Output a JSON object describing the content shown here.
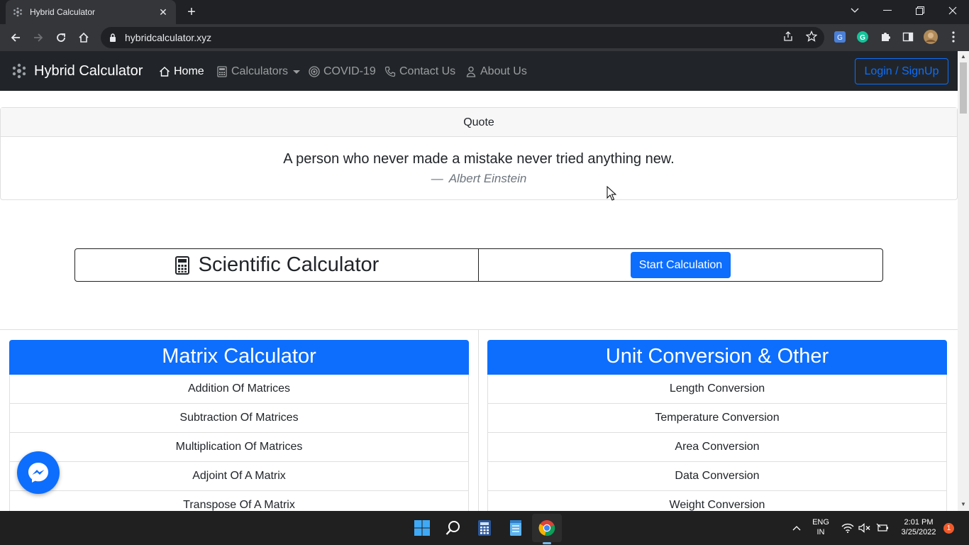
{
  "browser": {
    "tab_title": "Hybrid Calculator",
    "url": "hybridcalculator.xyz"
  },
  "site": {
    "brand": "Hybrid Calculator",
    "nav": {
      "home": "Home",
      "calculators": "Calculators",
      "covid": "COVID-19",
      "contact": "Contact Us",
      "about": "About Us"
    },
    "login": "Login / SignUp"
  },
  "quote": {
    "header": "Quote",
    "text": "A person who never made a mistake never tried anything new.",
    "author_prefix": "—",
    "author": "Albert Einstein"
  },
  "scientific": {
    "title": "Scientific Calculator",
    "button": "Start Calculation"
  },
  "matrix": {
    "title": "Matrix Calculator",
    "items": [
      "Addition Of Matrices",
      "Subtraction Of Matrices",
      "Multiplication Of Matrices",
      "Adjoint Of A Matrix",
      "Transpose Of A Matrix"
    ]
  },
  "units": {
    "title": "Unit Conversion & Other",
    "items": [
      "Length Conversion",
      "Temperature Conversion",
      "Area Conversion",
      "Data Conversion",
      "Weight Conversion"
    ]
  },
  "taskbar": {
    "lang_top": "ENG",
    "lang_bottom": "IN",
    "time": "2:01 PM",
    "date": "3/25/2022",
    "notifications": "1"
  },
  "colors": {
    "primary": "#0d6efd",
    "navbar": "#212529"
  }
}
